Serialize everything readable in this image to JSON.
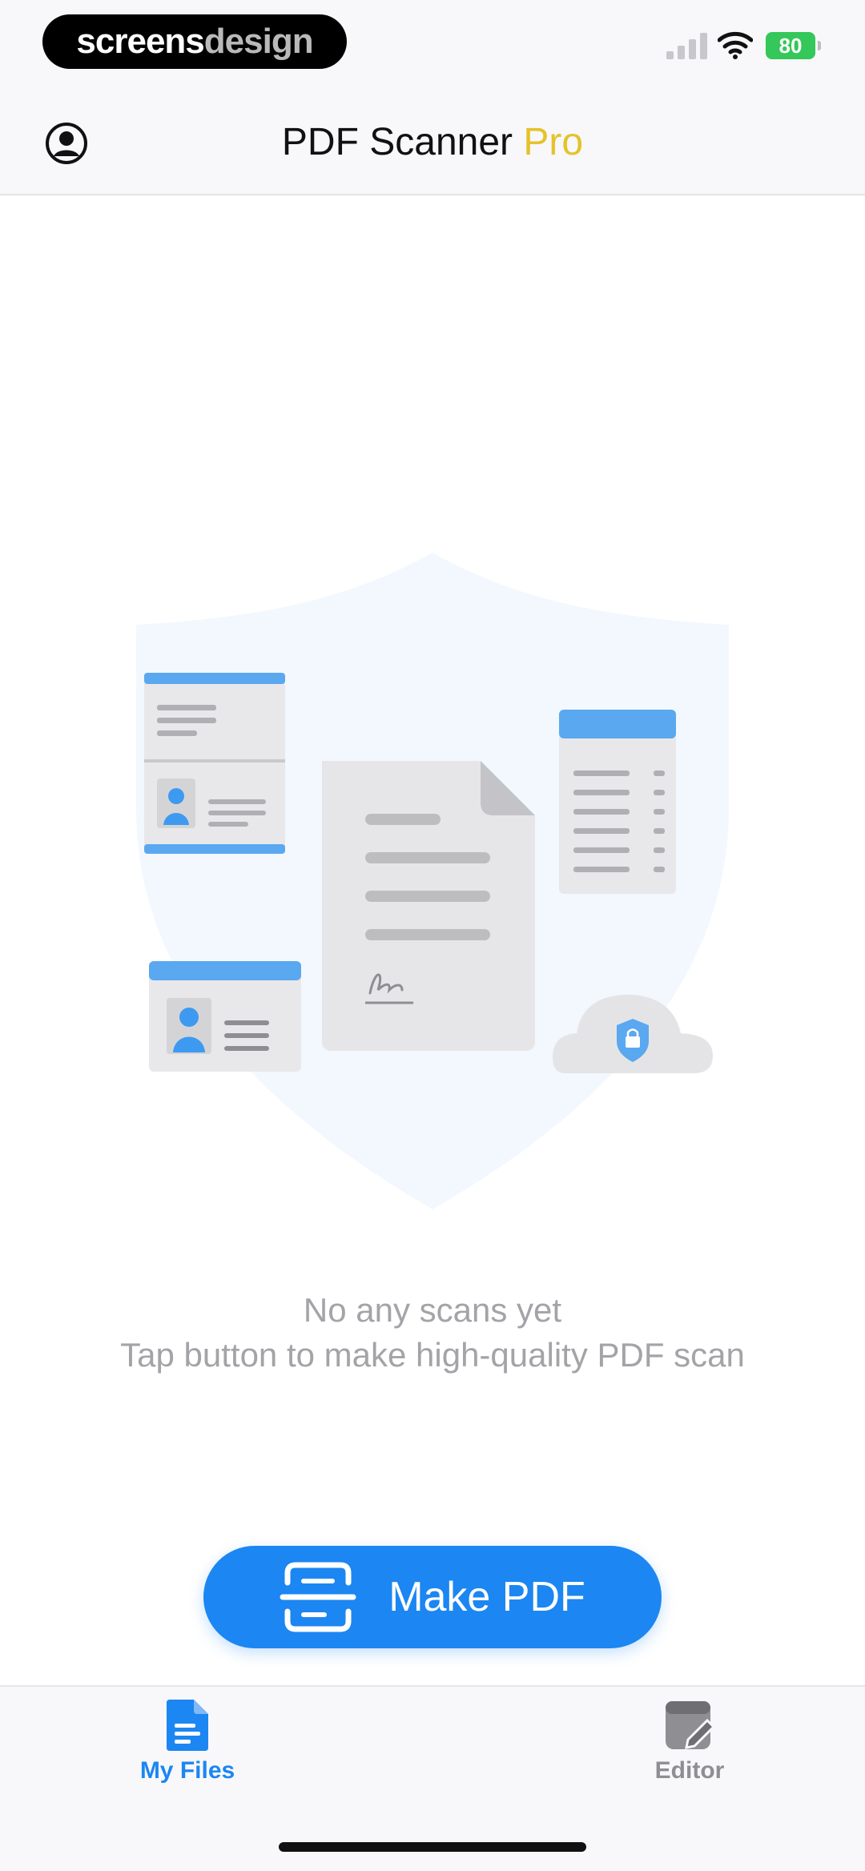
{
  "status_bar": {
    "brand_part1": "screens",
    "brand_part2": "design",
    "battery": "80"
  },
  "header": {
    "title_main": "PDF Scanner",
    "title_accent": "Pro",
    "profile_icon": "person-circle-icon"
  },
  "empty_state": {
    "line1": "No any scans yet",
    "line2": "Tap button to make high-quality PDF scan"
  },
  "primary_action": {
    "label": "Make PDF",
    "icon": "scan-document-icon",
    "color": "#1c86f2"
  },
  "tabs": [
    {
      "label": "My Files",
      "icon": "document-icon",
      "active": true
    },
    {
      "label": "Editor",
      "icon": "edit-document-icon",
      "active": false
    }
  ],
  "colors": {
    "accent": "#1c86f2",
    "pro": "#e5c22a",
    "battery": "#34c759",
    "muted_text": "#a3a3a8"
  }
}
